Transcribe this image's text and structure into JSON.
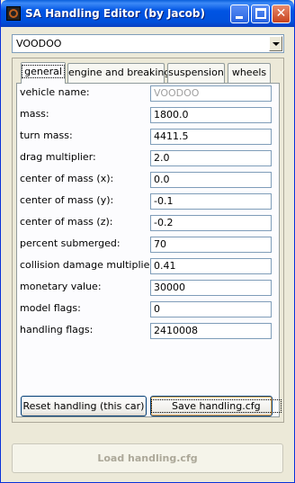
{
  "window": {
    "title": "SA Handling Editor (by Jacob)",
    "close_glyph": "✕"
  },
  "vehicle_select": {
    "value": "VOODOO"
  },
  "tabs": [
    {
      "label": "general"
    },
    {
      "label": "engine and breaking"
    },
    {
      "label": "suspension"
    },
    {
      "label": "wheels"
    }
  ],
  "fields": [
    {
      "label": "vehicle name:",
      "value": "VOODOO"
    },
    {
      "label": "mass:",
      "value": "1800.0"
    },
    {
      "label": "turn mass:",
      "value": "4411.5"
    },
    {
      "label": "drag multiplier:",
      "value": "2.0"
    },
    {
      "label": "center of mass (x):",
      "value": "0.0"
    },
    {
      "label": "center of mass (y):",
      "value": "-0.1"
    },
    {
      "label": "center of mass (z):",
      "value": "-0.2"
    },
    {
      "label": "percent submerged:",
      "value": "70"
    },
    {
      "label": "collision damage multiplier:",
      "value": "0.41"
    },
    {
      "label": "monetary value:",
      "value": "30000"
    },
    {
      "label": "model flags:",
      "value": "0"
    },
    {
      "label": "handling flags:",
      "value": "2410008"
    }
  ],
  "buttons": {
    "reset": "Reset handling (this car)",
    "save": "Save handling.cfg",
    "load": "Load handling.cfg"
  }
}
